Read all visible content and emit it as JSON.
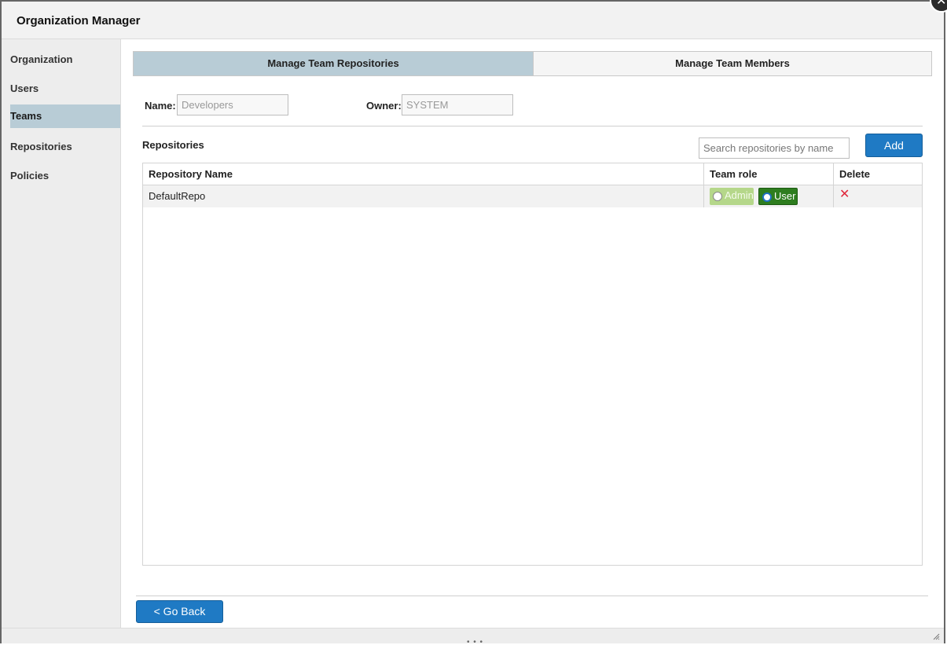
{
  "window": {
    "title": "Organization Manager",
    "close_icon": "close-icon"
  },
  "sidebar": {
    "items": [
      {
        "label": "Organization",
        "active": false
      },
      {
        "label": "Users",
        "active": false
      },
      {
        "label": "Teams",
        "active": true
      },
      {
        "label": "Repositories",
        "active": false
      },
      {
        "label": "Policies",
        "active": false
      }
    ]
  },
  "tabs": [
    {
      "label": "Manage Team Repositories",
      "active": true
    },
    {
      "label": "Manage Team Members",
      "active": false
    }
  ],
  "team": {
    "name_label": "Name:",
    "name_value": "Developers",
    "owner_label": "Owner:",
    "owner_value": "SYSTEM"
  },
  "repositories": {
    "section_title": "Repositories",
    "search_placeholder": "Search repositories by name",
    "add_label": "Add",
    "columns": [
      "Repository Name",
      "Team role",
      "Delete"
    ],
    "rows": [
      {
        "name": "DefaultRepo",
        "roles": [
          {
            "label": "Admin",
            "selected": false
          },
          {
            "label": "User",
            "selected": true
          }
        ],
        "delete_icon": "delete-x-icon"
      }
    ]
  },
  "footer": {
    "back_label": "< Go Back"
  },
  "colors": {
    "accent": "#1f7ac4",
    "selected_tab": "#b8ccd6",
    "user_role": "#2e7d1f",
    "admin_role": "#b5d78a",
    "delete": "#e0283c"
  }
}
